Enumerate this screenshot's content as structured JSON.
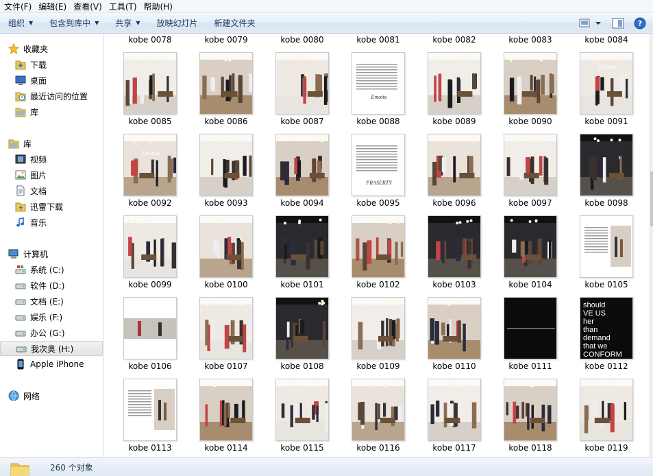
{
  "menubar": [
    {
      "label": "文件(F)"
    },
    {
      "label": "编辑(E)"
    },
    {
      "label": "查看(V)"
    },
    {
      "label": "工具(T)"
    },
    {
      "label": "帮助(H)"
    }
  ],
  "toolbar": {
    "organize": "组织",
    "include_library": "包含到库中",
    "share": "共享",
    "slideshow": "放映幻灯片",
    "new_folder": "新建文件夹"
  },
  "nav": {
    "favorites": {
      "label": "收藏夹",
      "icon": "star-icon",
      "items": [
        {
          "label": "下载",
          "icon": "download-folder-icon"
        },
        {
          "label": "桌面",
          "icon": "desktop-icon"
        },
        {
          "label": "最近访问的位置",
          "icon": "recent-places-icon"
        },
        {
          "label": "库",
          "icon": "library-icon"
        }
      ]
    },
    "libraries": {
      "label": "库",
      "icon": "library-icon",
      "items": [
        {
          "label": "视频",
          "icon": "video-icon"
        },
        {
          "label": "图片",
          "icon": "picture-icon"
        },
        {
          "label": "文档",
          "icon": "document-icon"
        },
        {
          "label": "迅雷下载",
          "icon": "thunder-download-icon"
        },
        {
          "label": "音乐",
          "icon": "music-icon"
        }
      ]
    },
    "computer": {
      "label": "计算机",
      "icon": "computer-icon",
      "items": [
        {
          "label": "系统 (C:)",
          "icon": "drive-c-icon"
        },
        {
          "label": "软件 (D:)",
          "icon": "drive-icon"
        },
        {
          "label": "文档 (E:)",
          "icon": "drive-icon"
        },
        {
          "label": "娱乐 (F:)",
          "icon": "drive-icon"
        },
        {
          "label": "办公 (G:)",
          "icon": "drive-icon"
        },
        {
          "label": "我次奥 (H:)",
          "icon": "drive-icon",
          "selected": true
        },
        {
          "label": "Apple iPhone",
          "icon": "phone-icon"
        }
      ]
    },
    "network": {
      "label": "网络",
      "icon": "network-icon"
    }
  },
  "files": {
    "top_row": [
      "kobe 0078",
      "kobe 0079",
      "kobe 0080",
      "kobe 0081",
      "kobe 0082",
      "kobe 0083",
      "kobe 0084"
    ],
    "rows": [
      [
        "kobe 0085",
        "kobe 0086",
        "kobe 0087",
        "kobe 0088",
        "kobe 0089",
        "kobe 0090",
        "kobe 0091"
      ],
      [
        "kobe 0092",
        "kobe 0093",
        "kobe 0094",
        "kobe 0095",
        "kobe 0096",
        "kobe 0097",
        "kobe 0098"
      ],
      [
        "kobe 0099",
        "kobe 0100",
        "kobe 0101",
        "kobe 0102",
        "kobe 0103",
        "kobe 0104",
        "kobe 0105"
      ],
      [
        "kobe 0106",
        "kobe 0107",
        "kobe 0108",
        "kobe 0109",
        "kobe 0110",
        "kobe 0111",
        "kobe 0112"
      ],
      [
        "kobe 0113",
        "kobe 0114",
        "kobe 0115",
        "kobe 0116",
        "kobe 0117",
        "kobe 0118",
        "kobe 0119"
      ]
    ]
  },
  "thumb_text": {
    "brand_0088": "Emotto",
    "brand_0091": "Emotto",
    "brand_0092": "Emotto",
    "brand_0095": "PRASERTY",
    "poster_0112": [
      "should",
      "VE US",
      "her",
      "than",
      "demand",
      "that we",
      "CONFORM"
    ]
  },
  "status": {
    "count": "260 个对象"
  }
}
